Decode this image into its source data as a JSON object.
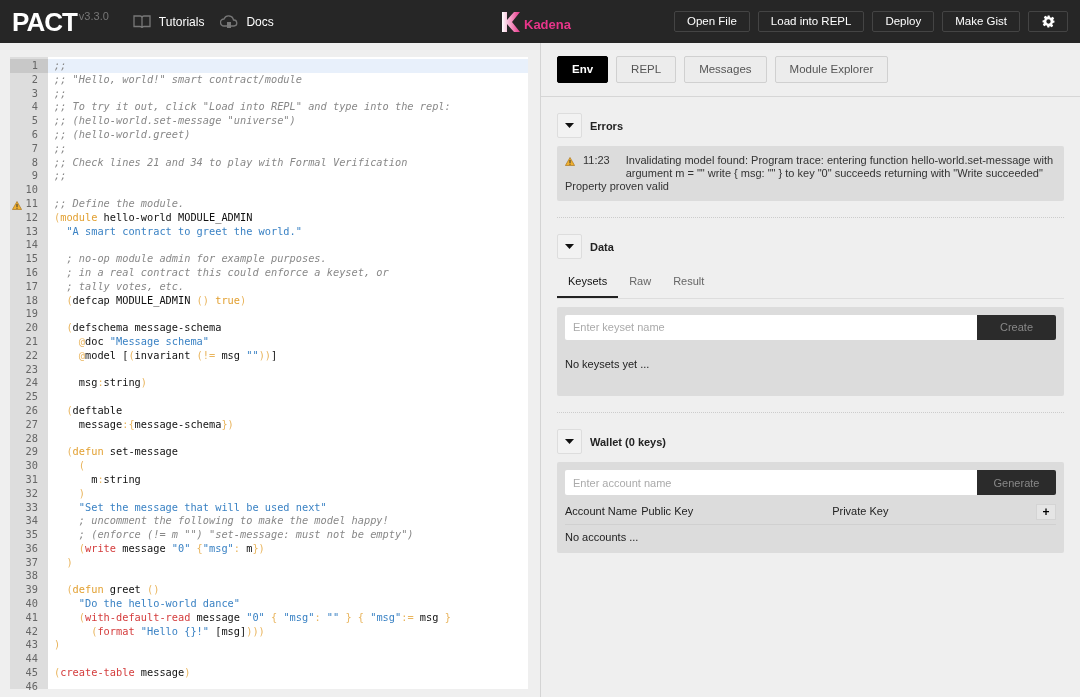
{
  "header": {
    "logo": "PACT",
    "version": "v3.3.0",
    "links": [
      {
        "label": "Tutorials",
        "kind": "book"
      },
      {
        "label": "Docs",
        "kind": "cloud"
      }
    ],
    "brand": "Kadena",
    "buttons": [
      "Open File",
      "Load into REPL",
      "Deploy",
      "Make Gist"
    ]
  },
  "editor": {
    "lines": [
      {
        "number": "1",
        "active": true,
        "warning": false,
        "tokens": [
          {
            "text": ";;",
            "kind": "comment"
          }
        ]
      },
      {
        "number": "2",
        "active": false,
        "warning": false,
        "tokens": [
          {
            "text": ";; \"Hello, world!\" smart contract/module",
            "kind": "comment"
          }
        ]
      },
      {
        "number": "3",
        "active": false,
        "warning": false,
        "tokens": [
          {
            "text": ";;",
            "kind": "comment"
          }
        ]
      },
      {
        "number": "4",
        "active": false,
        "warning": false,
        "tokens": [
          {
            "text": ";; To try it out, click \"Load into REPL\" and type into the repl:",
            "kind": "comment"
          }
        ]
      },
      {
        "number": "5",
        "active": false,
        "warning": false,
        "tokens": [
          {
            "text": ";; (hello-world.set-message \"universe\")",
            "kind": "comment"
          }
        ]
      },
      {
        "number": "6",
        "active": false,
        "warning": false,
        "tokens": [
          {
            "text": ";; (hello-world.greet)",
            "kind": "comment"
          }
        ]
      },
      {
        "number": "7",
        "active": false,
        "warning": false,
        "tokens": [
          {
            "text": ";;",
            "kind": "comment"
          }
        ]
      },
      {
        "number": "8",
        "active": false,
        "warning": false,
        "tokens": [
          {
            "text": ";; Check lines 21 and 34 to play with Formal Verification",
            "kind": "comment"
          }
        ]
      },
      {
        "number": "9",
        "active": false,
        "warning": false,
        "tokens": [
          {
            "text": ";;",
            "kind": "comment"
          }
        ]
      },
      {
        "number": "10",
        "active": false,
        "warning": false
      },
      {
        "number": "11",
        "active": false,
        "warning": true,
        "tokens": [
          {
            "text": ";; Define the module.",
            "kind": "comment"
          }
        ]
      },
      {
        "number": "12",
        "active": false,
        "warning": false,
        "tokens": [
          {
            "text": "(",
            "kind": "punct"
          },
          {
            "text": "module",
            "kind": "keyword"
          },
          {
            "text": " hello-world MODULE_ADMIN",
            "kind": "plain"
          }
        ]
      },
      {
        "number": "13",
        "active": false,
        "warning": false,
        "tokens": [
          {
            "text": "  \"A smart contract to greet the world.\"",
            "kind": "string"
          }
        ]
      },
      {
        "number": "14",
        "active": false,
        "warning": false
      },
      {
        "number": "15",
        "active": false,
        "warning": false,
        "tokens": [
          {
            "text": "  ; no-op module admin for example purposes.",
            "kind": "comment"
          }
        ]
      },
      {
        "number": "16",
        "active": false,
        "warning": false,
        "tokens": [
          {
            "text": "  ; in a real contract this could enforce a keyset, or",
            "kind": "comment"
          }
        ]
      },
      {
        "number": "17",
        "active": false,
        "warning": false,
        "tokens": [
          {
            "text": "  ; tally votes, etc.",
            "kind": "comment"
          }
        ]
      },
      {
        "number": "18",
        "active": false,
        "warning": false,
        "tokens": [
          {
            "text": "  (",
            "kind": "punct"
          },
          {
            "text": "defcap MODULE_ADMIN ",
            "kind": "plain"
          },
          {
            "text": "()",
            "kind": "punct"
          },
          {
            "text": " true",
            "kind": "keyword"
          },
          {
            "text": ")",
            "kind": "punct"
          }
        ]
      },
      {
        "number": "19",
        "active": false,
        "warning": false
      },
      {
        "number": "20",
        "active": false,
        "warning": false,
        "tokens": [
          {
            "text": "  (",
            "kind": "punct"
          },
          {
            "text": "defschema message-schema",
            "kind": "plain"
          }
        ]
      },
      {
        "number": "21",
        "active": false,
        "warning": false,
        "tokens": [
          {
            "text": "    @",
            "kind": "punct"
          },
          {
            "text": "doc ",
            "kind": "plain"
          },
          {
            "text": "\"Message schema\"",
            "kind": "string"
          }
        ]
      },
      {
        "number": "22",
        "active": false,
        "warning": false,
        "tokens": [
          {
            "text": "    @",
            "kind": "punct"
          },
          {
            "text": "model [",
            "kind": "plain"
          },
          {
            "text": "(",
            "kind": "punct"
          },
          {
            "text": "invariant ",
            "kind": "plain"
          },
          {
            "text": "(!=",
            "kind": "punct"
          },
          {
            "text": " msg ",
            "kind": "plain"
          },
          {
            "text": "\"\"",
            "kind": "string"
          },
          {
            "text": "))",
            "kind": "punct"
          },
          {
            "text": "]",
            "kind": "plain"
          }
        ]
      },
      {
        "number": "23",
        "active": false,
        "warning": false
      },
      {
        "number": "24",
        "active": false,
        "warning": false,
        "tokens": [
          {
            "text": "    msg",
            "kind": "plain"
          },
          {
            "text": ":",
            "kind": "punct"
          },
          {
            "text": "string",
            "kind": "plain"
          },
          {
            "text": ")",
            "kind": "punct"
          }
        ]
      },
      {
        "number": "25",
        "active": false,
        "warning": false
      },
      {
        "number": "26",
        "active": false,
        "warning": false,
        "tokens": [
          {
            "text": "  (",
            "kind": "punct"
          },
          {
            "text": "deftable",
            "kind": "plain"
          }
        ]
      },
      {
        "number": "27",
        "active": false,
        "warning": false,
        "tokens": [
          {
            "text": "    message",
            "kind": "plain"
          },
          {
            "text": ":{",
            "kind": "punct"
          },
          {
            "text": "message-schema",
            "kind": "plain"
          },
          {
            "text": "})",
            "kind": "punct"
          }
        ]
      },
      {
        "number": "28",
        "active": false,
        "warning": false
      },
      {
        "number": "29",
        "active": false,
        "warning": false,
        "tokens": [
          {
            "text": "  (",
            "kind": "punct"
          },
          {
            "text": "defun",
            "kind": "keyword"
          },
          {
            "text": " set-message",
            "kind": "plain"
          }
        ]
      },
      {
        "number": "30",
        "active": false,
        "warning": false,
        "tokens": [
          {
            "text": "    (",
            "kind": "punct"
          }
        ]
      },
      {
        "number": "31",
        "active": false,
        "warning": false,
        "tokens": [
          {
            "text": "      m",
            "kind": "plain"
          },
          {
            "text": ":",
            "kind": "punct"
          },
          {
            "text": "string",
            "kind": "plain"
          }
        ]
      },
      {
        "number": "32",
        "active": false,
        "warning": false,
        "tokens": [
          {
            "text": "    )",
            "kind": "punct"
          }
        ]
      },
      {
        "number": "33",
        "active": false,
        "warning": false,
        "tokens": [
          {
            "text": "    \"Set the message that will be used next\"",
            "kind": "string"
          }
        ]
      },
      {
        "number": "34",
        "active": false,
        "warning": false,
        "tokens": [
          {
            "text": "    ; uncomment the following to make the model happy!",
            "kind": "comment"
          }
        ]
      },
      {
        "number": "35",
        "active": false,
        "warning": false,
        "tokens": [
          {
            "text": "    ; (enforce (!= m \"\") \"set-message: must not be empty\")",
            "kind": "comment"
          }
        ]
      },
      {
        "number": "36",
        "active": false,
        "warning": false,
        "tokens": [
          {
            "text": "    (",
            "kind": "punct"
          },
          {
            "text": "write",
            "kind": "builtin"
          },
          {
            "text": " message ",
            "kind": "plain"
          },
          {
            "text": "\"0\"",
            "kind": "string"
          },
          {
            "text": " {",
            "kind": "punct"
          },
          {
            "text": "\"msg\"",
            "kind": "string"
          },
          {
            "text": ": ",
            "kind": "punct"
          },
          {
            "text": "m",
            "kind": "plain"
          },
          {
            "text": "})",
            "kind": "punct"
          }
        ]
      },
      {
        "number": "37",
        "active": false,
        "warning": false,
        "tokens": [
          {
            "text": "  )",
            "kind": "punct"
          }
        ]
      },
      {
        "number": "38",
        "active": false,
        "warning": false
      },
      {
        "number": "39",
        "active": false,
        "warning": false,
        "tokens": [
          {
            "text": "  (",
            "kind": "punct"
          },
          {
            "text": "defun",
            "kind": "keyword"
          },
          {
            "text": " greet ",
            "kind": "plain"
          },
          {
            "text": "()",
            "kind": "punct"
          }
        ]
      },
      {
        "number": "40",
        "active": false,
        "warning": false,
        "tokens": [
          {
            "text": "    \"Do the hello-world dance\"",
            "kind": "string"
          }
        ]
      },
      {
        "number": "41",
        "active": false,
        "warning": false,
        "tokens": [
          {
            "text": "    (",
            "kind": "punct"
          },
          {
            "text": "with-default-read",
            "kind": "builtin"
          },
          {
            "text": " message ",
            "kind": "plain"
          },
          {
            "text": "\"0\"",
            "kind": "string"
          },
          {
            "text": " { ",
            "kind": "punct"
          },
          {
            "text": "\"msg\"",
            "kind": "string"
          },
          {
            "text": ": ",
            "kind": "punct"
          },
          {
            "text": "\"\"",
            "kind": "string"
          },
          {
            "text": " } { ",
            "kind": "punct"
          },
          {
            "text": "\"msg\"",
            "kind": "string"
          },
          {
            "text": ":= ",
            "kind": "punct"
          },
          {
            "text": "msg ",
            "kind": "plain"
          },
          {
            "text": "}",
            "kind": "punct"
          }
        ]
      },
      {
        "number": "42",
        "active": false,
        "warning": false,
        "tokens": [
          {
            "text": "      (",
            "kind": "punct"
          },
          {
            "text": "format",
            "kind": "builtin"
          },
          {
            "text": " \"Hello {}!\"",
            "kind": "string"
          },
          {
            "text": " [msg]",
            "kind": "plain"
          },
          {
            "text": ")))",
            "kind": "punct"
          }
        ]
      },
      {
        "number": "43",
        "active": false,
        "warning": false,
        "tokens": [
          {
            "text": ")",
            "kind": "punct"
          }
        ]
      },
      {
        "number": "44",
        "active": false,
        "warning": false
      },
      {
        "number": "45",
        "active": false,
        "warning": false,
        "tokens": [
          {
            "text": "(",
            "kind": "punct"
          },
          {
            "text": "create-table",
            "kind": "builtin"
          },
          {
            "text": " message",
            "kind": "plain"
          },
          {
            "text": ")",
            "kind": "punct"
          }
        ]
      },
      {
        "number": "46",
        "active": false,
        "warning": false
      }
    ]
  },
  "tabs": [
    {
      "label": "Env",
      "selected": true
    },
    {
      "label": "REPL",
      "selected": false
    },
    {
      "label": "Messages",
      "selected": false
    },
    {
      "label": "Module Explorer",
      "selected": false
    }
  ],
  "errors": {
    "title": "Errors",
    "expanded": true,
    "entries": [
      {
        "kind": "warning",
        "time": "11:23",
        "text": "Invalidating model found: Program trace: entering function hello-world.set-message with argument m = \"\" write { msg: \"\" } to key \"0\" succeeds returning with \"Write succeeded\""
      },
      {
        "kind": "info",
        "text": "Property proven valid"
      }
    ]
  },
  "data": {
    "title": "Data",
    "expanded": true,
    "tabs": [
      {
        "label": "Keysets",
        "selected": true
      },
      {
        "label": "Raw",
        "selected": false
      },
      {
        "label": "Result",
        "selected": false
      }
    ],
    "placeholder": "Enter keyset name",
    "button": "Create",
    "empty": "No keysets yet ..."
  },
  "wallet": {
    "title": "Wallet (0 keys)",
    "expanded": true,
    "placeholder": "Enter account name",
    "button": "Generate",
    "columns": [
      "Account Name",
      "Public Key",
      "Private Key"
    ],
    "add": "+",
    "empty": "No accounts ..."
  }
}
